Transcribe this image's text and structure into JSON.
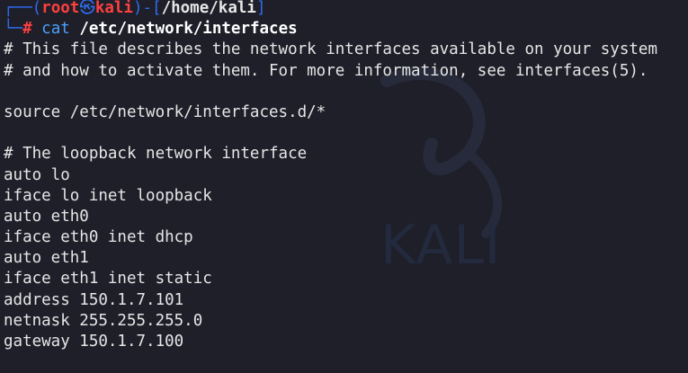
{
  "prompt": {
    "open_bracket": "┌──(",
    "user": "root",
    "separator": "㉿",
    "host": "kali",
    "mid": ")-[",
    "path": "/home/kali",
    "close": "]",
    "corner": "└─",
    "hash": "#",
    "command": "cat",
    "args": "/etc/network/interfaces"
  },
  "output_lines": [
    "# This file describes the network interfaces available on your system",
    "# and how to activate them. For more information, see interfaces(5).",
    "",
    "source /etc/network/interfaces.d/*",
    "",
    "# The loopback network interface",
    "auto lo",
    "iface lo inet loopback",
    "auto eth0",
    "iface eth0 inet dhcp",
    "auto eth1",
    "iface eth1 inet static",
    "address 150.1.7.101",
    "netnask 255.255.255.0",
    "gateway 150.1.7.100"
  ],
  "watermark": {
    "text": "KALI"
  },
  "colors": {
    "background": "#1e1f29",
    "prompt_frame": "#2f6cf0",
    "prompt_user": "#ff4040",
    "command": "#4aa0ff",
    "text": "#e6e6e6"
  }
}
